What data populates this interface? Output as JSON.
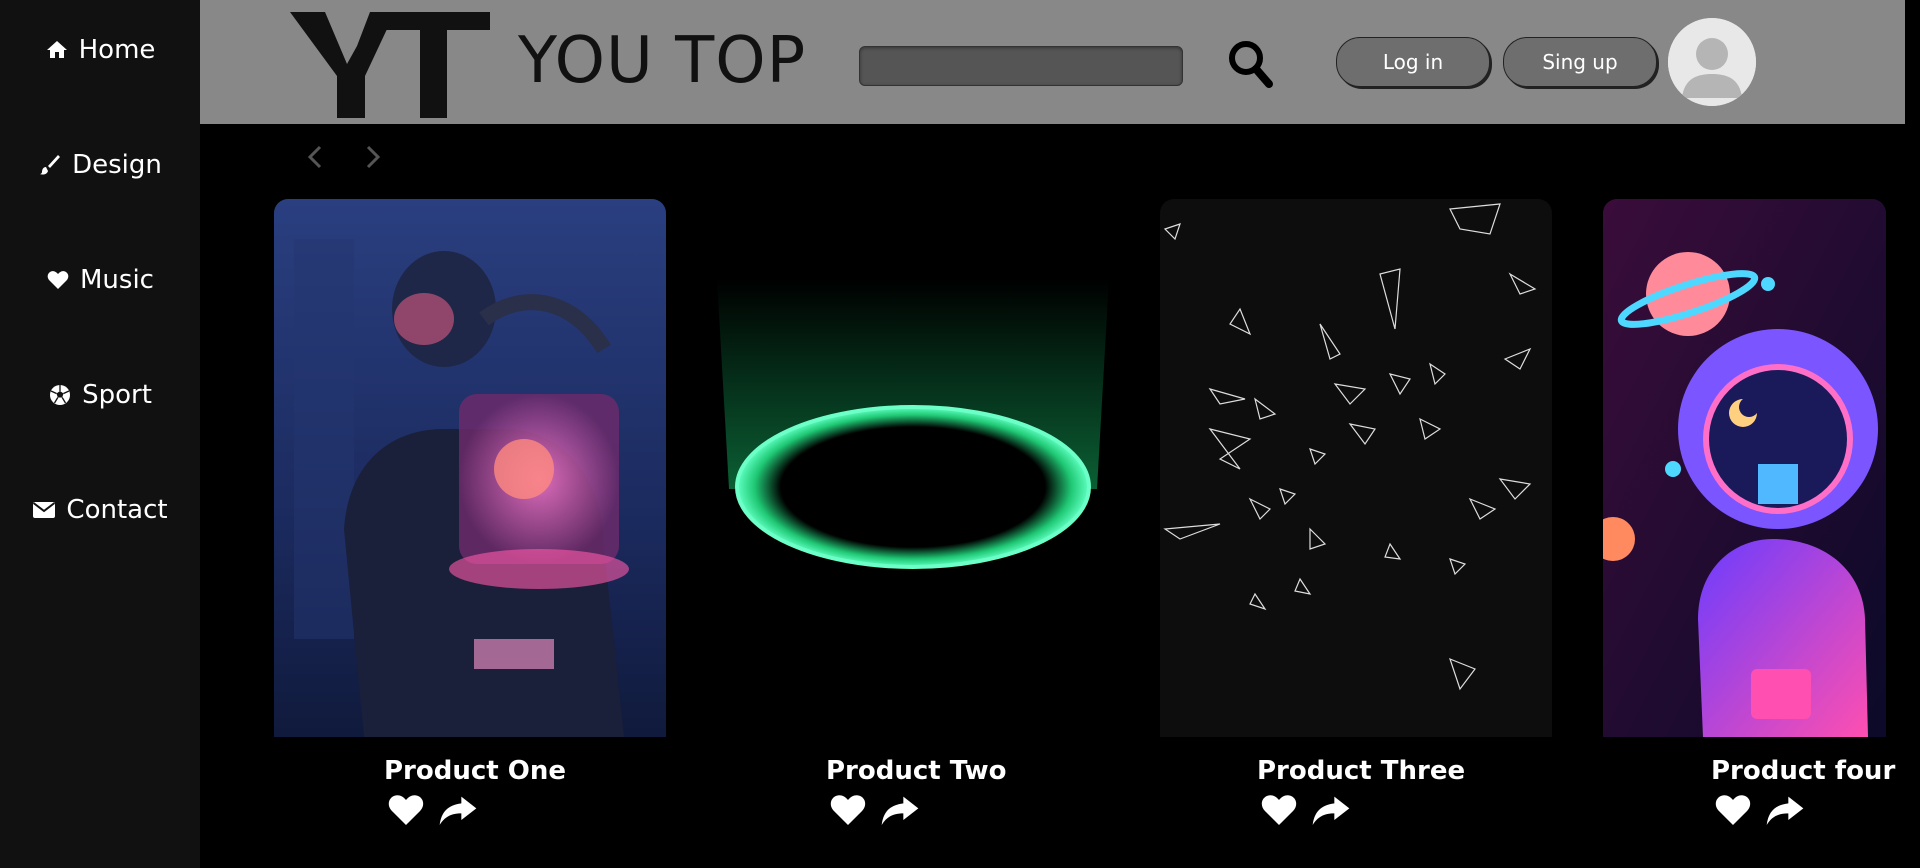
{
  "sidebar": {
    "items": [
      {
        "label": "Home",
        "icon": "home-icon"
      },
      {
        "label": "Design",
        "icon": "paintbrush-icon"
      },
      {
        "label": "Music",
        "icon": "heart-icon"
      },
      {
        "label": "Sport",
        "icon": "soccer-ball-icon"
      },
      {
        "label": "Contact",
        "icon": "envelope-icon"
      }
    ]
  },
  "header": {
    "brand": "YOU TOP",
    "search_placeholder": "",
    "login_label": "Log in",
    "signup_label": "Sing up"
  },
  "products": [
    {
      "title": "Product One"
    },
    {
      "title": "Product Two"
    },
    {
      "title": "Product Three"
    },
    {
      "title": "Product four"
    }
  ],
  "colors": {
    "sidebar_bg": "#111111",
    "header_bg": "#888888",
    "page_bg": "#000000",
    "button_bg": "#6e6e6e",
    "accent_green": "#2bff9a"
  }
}
